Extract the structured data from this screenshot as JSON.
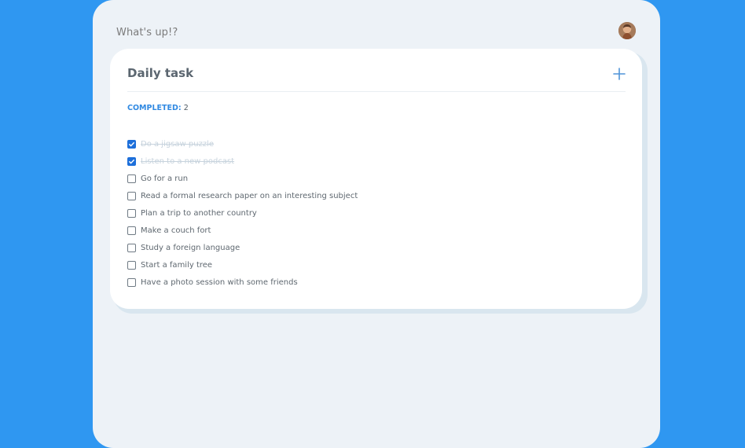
{
  "header": {
    "greeting": "What's up!?"
  },
  "card": {
    "title": "Daily task",
    "completed_label": "COMPLETED:",
    "completed_count": "2"
  },
  "icons": {
    "add": "plus-icon",
    "check": "check-icon",
    "avatar": "user-avatar"
  },
  "colors": {
    "background": "#2f97f1",
    "frame": "#edf2f7",
    "card": "#ffffff",
    "accent": "#3089e2",
    "checkbox_checked": "#1d6fda"
  },
  "tasks": [
    {
      "text": "Do a jigsaw puzzle",
      "done": true
    },
    {
      "text": "Listen to a new podcast",
      "done": true
    },
    {
      "text": "Go for a run",
      "done": false
    },
    {
      "text": "Read a formal research paper on an interesting subject",
      "done": false
    },
    {
      "text": "Plan a trip to another country",
      "done": false
    },
    {
      "text": "Make a couch fort",
      "done": false
    },
    {
      "text": "Study a foreign language",
      "done": false
    },
    {
      "text": "Start a family tree",
      "done": false
    },
    {
      "text": "Have a photo session with some friends",
      "done": false
    }
  ]
}
